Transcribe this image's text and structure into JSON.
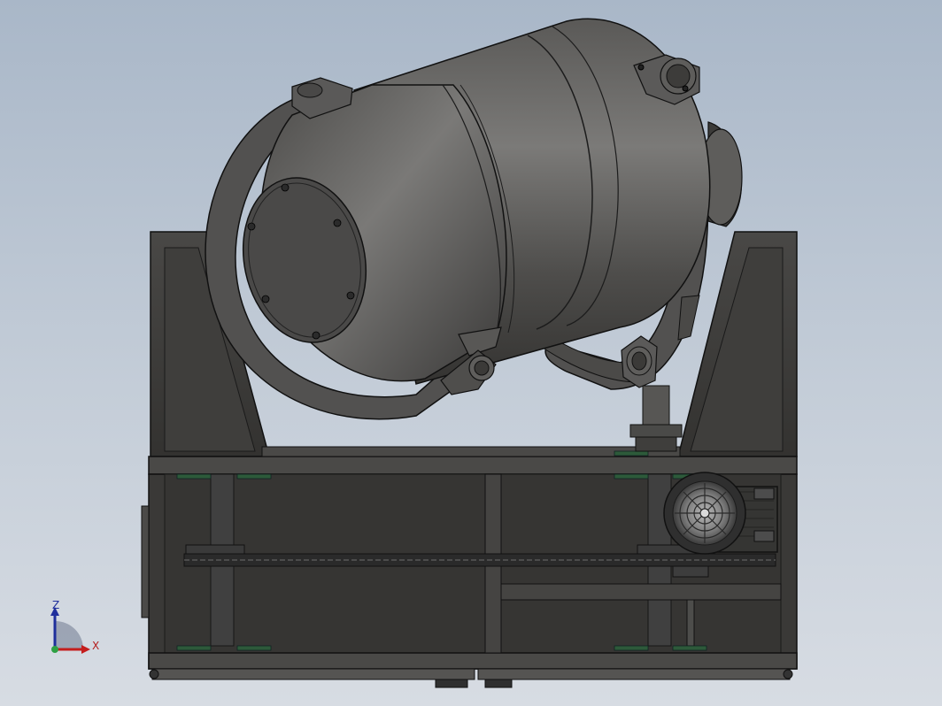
{
  "viewport": {
    "background_top": "#a9b7c8",
    "background_bottom": "#d7dce3"
  },
  "model": {
    "description_icon": "drum-mixer-model",
    "body_color": "#4a4948",
    "frame_color": "#3d3d3b",
    "edge_color": "#111111"
  },
  "triad": {
    "z_label": "Z",
    "x_label": "X",
    "z_color": "#1f2f9c",
    "x_color": "#c41d1d",
    "y_color": "#2ea043"
  }
}
